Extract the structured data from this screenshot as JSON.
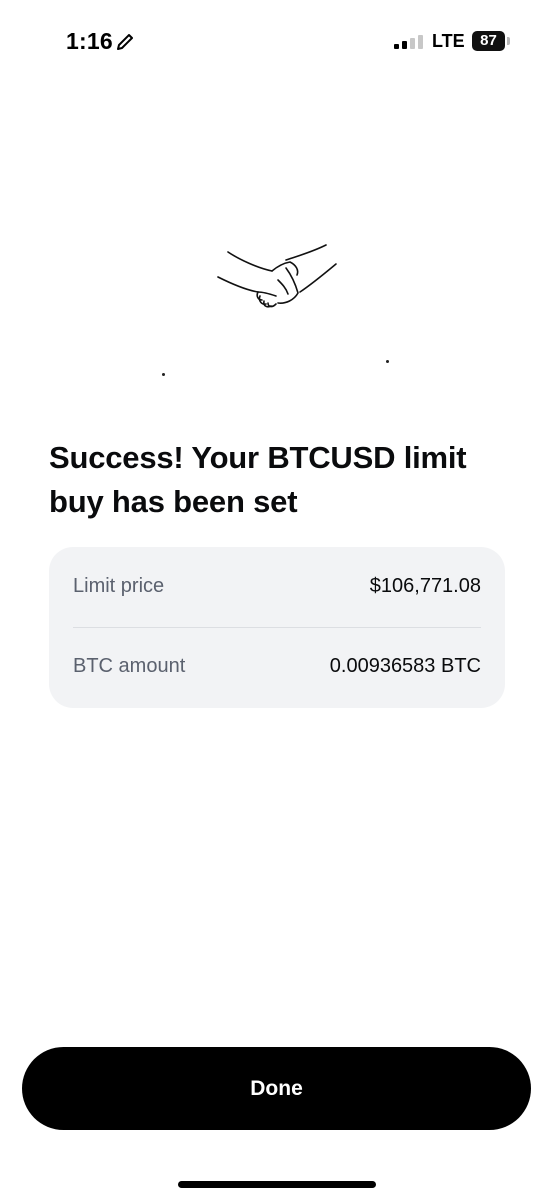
{
  "status_bar": {
    "time": "1:16",
    "network": "LTE",
    "battery": "87",
    "icons": [
      "pencil-icon",
      "signal-icon",
      "battery-icon"
    ]
  },
  "illustration": {
    "icon": "handshake-icon"
  },
  "title": "Success! Your BTCUSD limit buy has been set",
  "details": {
    "rows": [
      {
        "label": "Limit price",
        "value": "$106,771.08"
      },
      {
        "label": "BTC amount",
        "value": "0.00936583 BTC"
      }
    ]
  },
  "done_button": {
    "label": "Done"
  },
  "colors": {
    "card_background": "#f2f3f5",
    "label_text": "#5b616e",
    "button_background": "#000000",
    "button_text": "#ffffff"
  }
}
